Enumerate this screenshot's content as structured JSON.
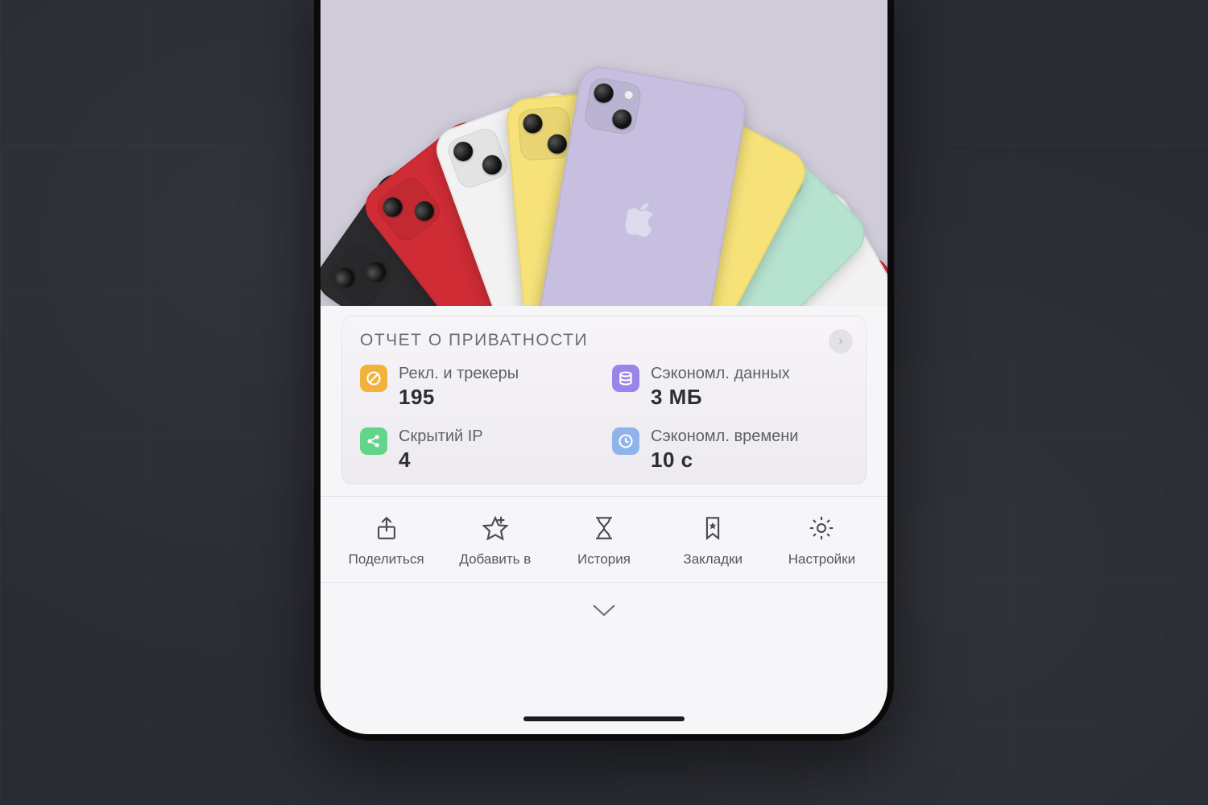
{
  "privacy_panel": {
    "title": "ОТЧЕТ О ПРИВАТНОСТИ",
    "stats": {
      "ads": {
        "label": "Рекл. и трекеры",
        "value": "195"
      },
      "data": {
        "label": "Сэкономл. данных",
        "value": "3 МБ"
      },
      "ip": {
        "label": "Скрытий IP",
        "value": "4"
      },
      "time": {
        "label": "Сэкономл. времени",
        "value": "10 с"
      }
    }
  },
  "actions": {
    "share": "Поделиться",
    "add": "Добавить в",
    "history": "История",
    "bookmarks": "Закладки",
    "settings": "Настройки"
  }
}
